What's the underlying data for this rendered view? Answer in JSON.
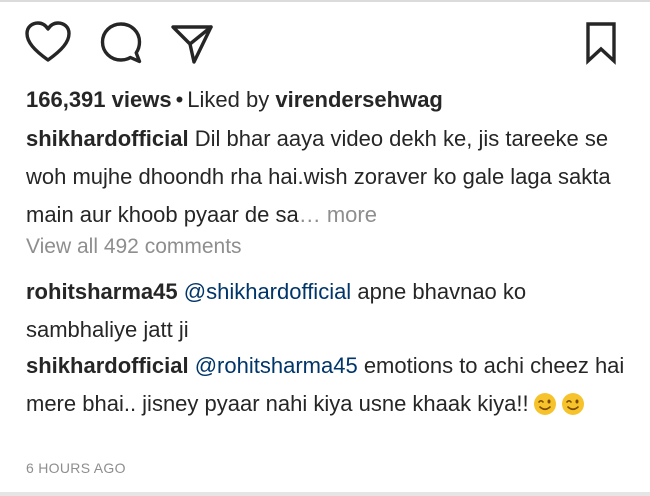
{
  "actions": {
    "like_icon": "heart-outline",
    "comment_icon": "speech-bubble",
    "share_icon": "paper-plane",
    "save_icon": "bookmark"
  },
  "stats": {
    "views": "166,391 views",
    "separator": "•",
    "liked_by_prefix": "Liked by",
    "liked_by_user": "virendersehwag"
  },
  "caption": {
    "username": "shikhardofficial",
    "text": "Dil bhar aaya video dekh ke, jis tareeke se woh mujhe dhoondh rha hai.wish zoraver ko gale laga sakta main aur khoob pyaar de sa",
    "ellipsis": "…",
    "more_label": "more"
  },
  "comments_link": "View all 492 comments",
  "comments": [
    {
      "username": "rohitsharma45",
      "mention": "@shikhardofficial",
      "text": "apne bhavnao ko sambhaliye jatt ji"
    },
    {
      "username": "shikhardofficial",
      "mention": "@rohitsharma45",
      "text": "emotions to achi cheez hai mere bhai.. jisney pyaar nahi kiya usne khaak kiya!!",
      "emojis": [
        "winking-face",
        "winking-face"
      ]
    }
  ],
  "timestamp": "6 HOURS AGO",
  "colors": {
    "text": "#262626",
    "muted": "#8e8e8e",
    "mention": "#003569",
    "emoji": "#f6c32c"
  }
}
